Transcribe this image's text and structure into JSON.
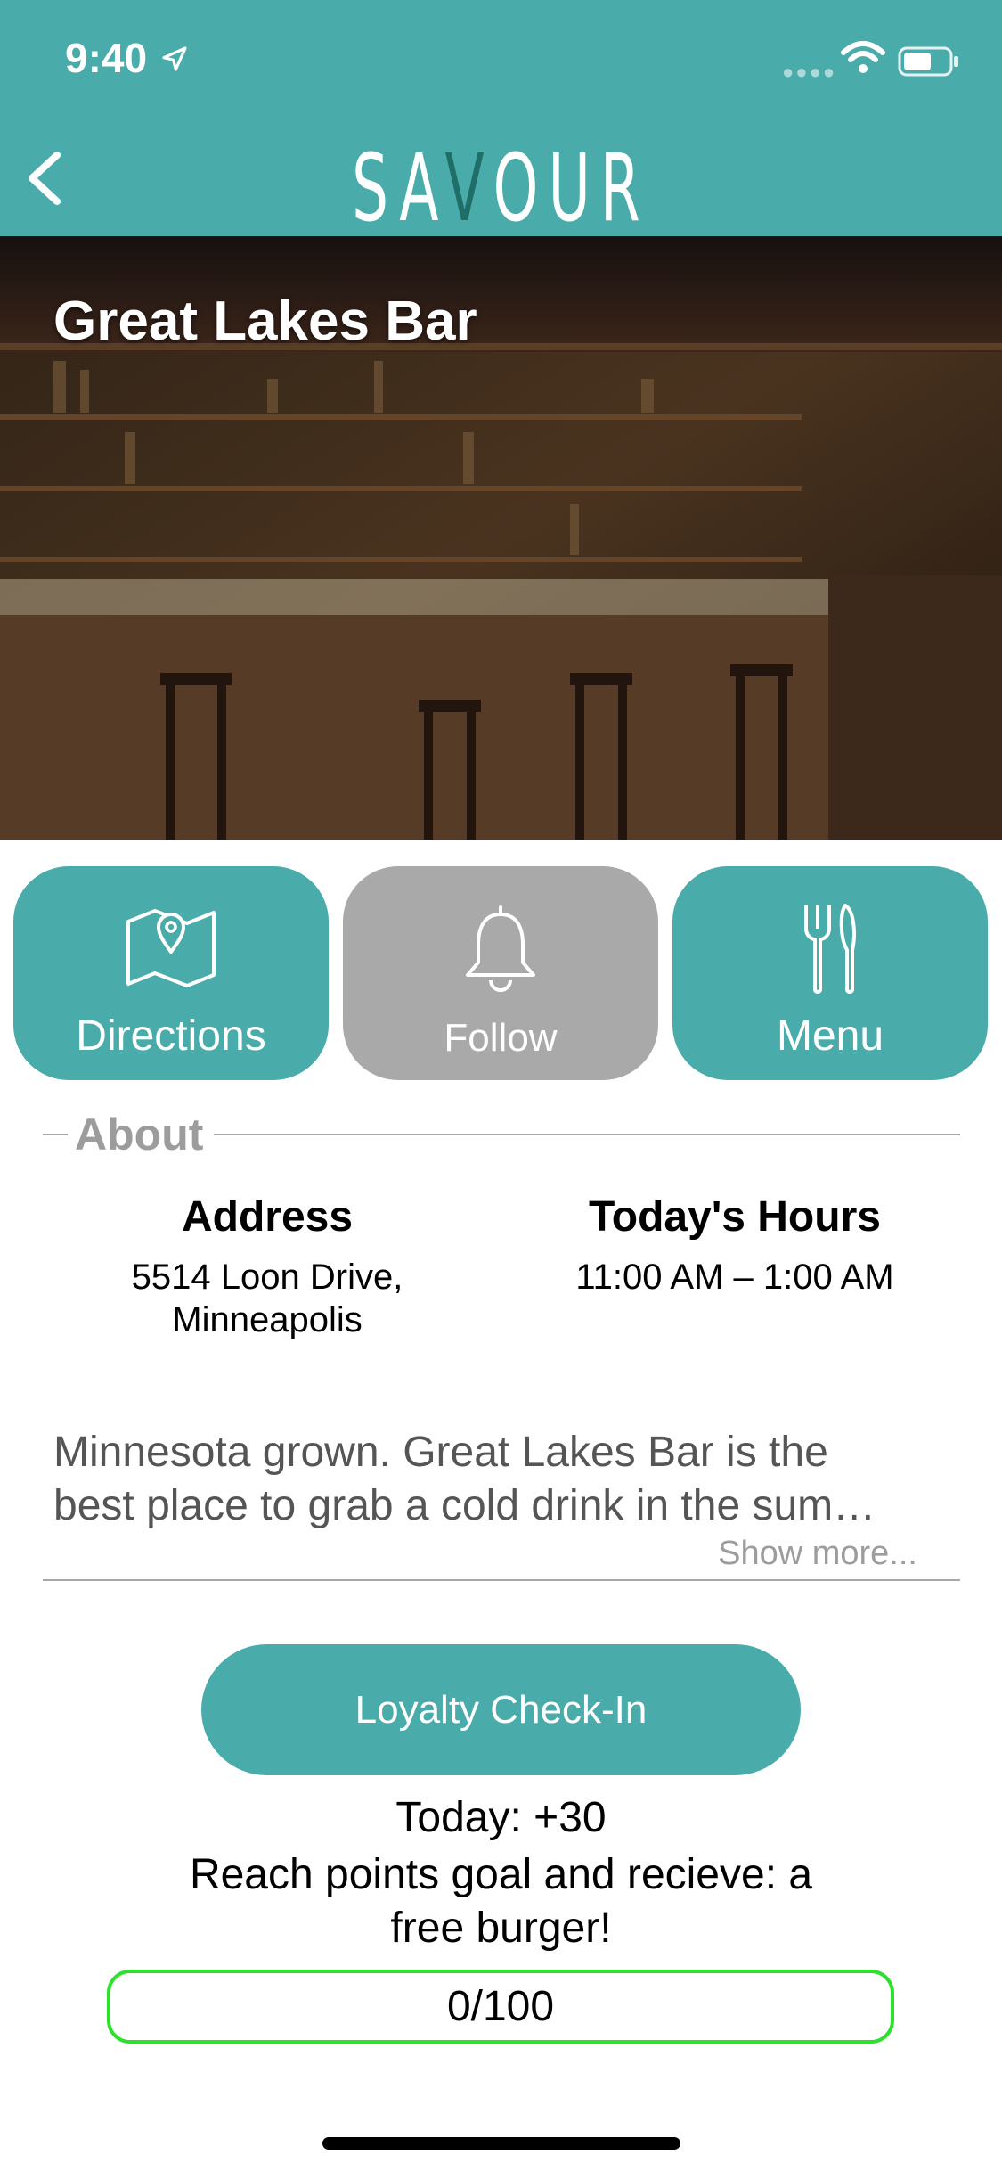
{
  "status_bar": {
    "time": "9:40"
  },
  "header": {
    "brand_before": "SA",
    "brand_accent": "V",
    "brand_after": "OUR"
  },
  "hero": {
    "title": "Great Lakes Bar"
  },
  "actions": [
    {
      "label": "Directions",
      "icon": "map-pin-icon",
      "color": "#4aacaa"
    },
    {
      "label": "Follow",
      "icon": "bell-icon",
      "color": "#a9a9a9"
    },
    {
      "label": "Menu",
      "icon": "fork-knife-icon",
      "color": "#4aacaa"
    }
  ],
  "about": {
    "heading": "About",
    "address_title": "Address",
    "address_line1": "5514 Loon Drive,",
    "address_line2": "Minneapolis",
    "hours_title": "Today's Hours",
    "hours_value": "11:00 AM – 1:00 AM",
    "description_line1": "Minnesota grown. Great Lakes Bar is the",
    "description_line2": "best place to grab a cold drink in the sum…",
    "show_more": "Show more..."
  },
  "loyalty": {
    "button_label": "Loyalty Check-In",
    "today": "Today: +30",
    "reward_line1": "Reach points goal and recieve: a",
    "reward_line2": "free burger!",
    "progress_label": "0/100",
    "progress_fraction": 0,
    "accent": "#2ee02e"
  },
  "colors": {
    "primary": "#4aacaa",
    "follow_gray": "#a9a9a9"
  }
}
